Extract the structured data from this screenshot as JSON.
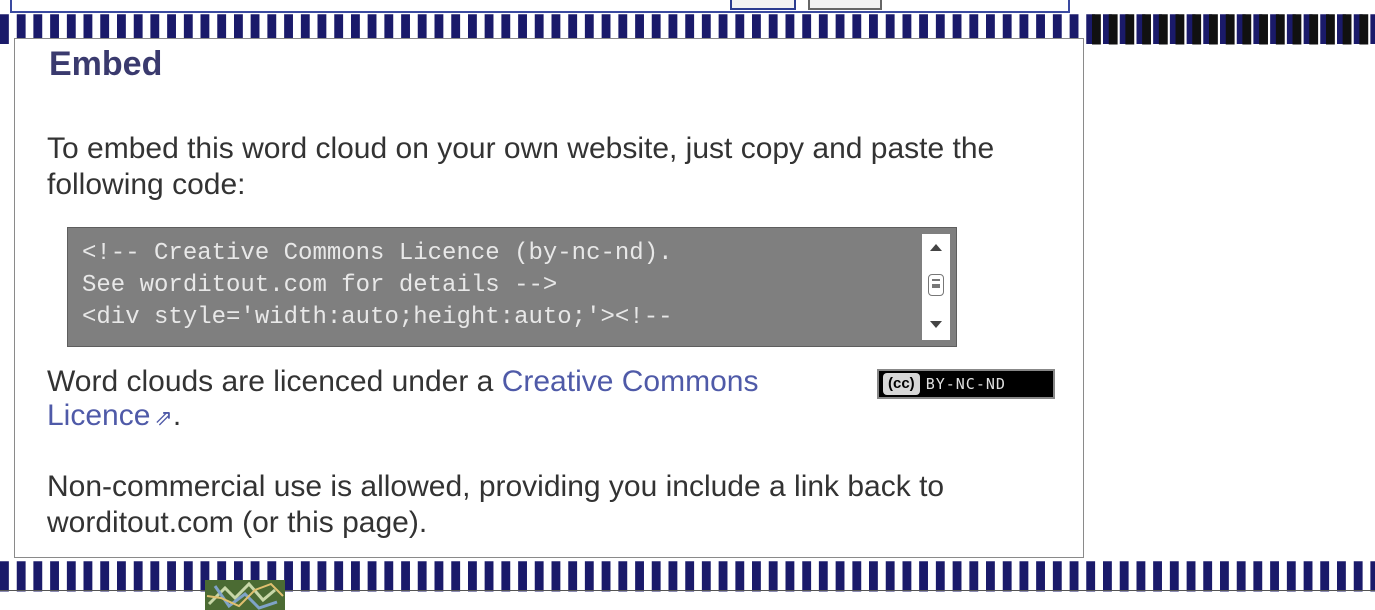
{
  "embed": {
    "title": "Embed",
    "intro": "To embed this word cloud on your own website, just copy and paste the following code:",
    "code_lines": [
      "<!-- Creative Commons Licence (by-nc-nd).",
      "See worditout.com for details -->",
      "<div style='width:auto;height:auto;'><!--"
    ],
    "licence_prefix": "Word clouds are licenced under a ",
    "licence_link": "Creative Commons Licence",
    "licence_suffix": ".",
    "external_icon": "external-link-icon",
    "badge_logo": "(cc)",
    "badge_terms": "BY-NC-ND",
    "noncommercial": "Non-commercial use is allowed, providing you include a link back to worditout.com (or this page)."
  },
  "colors": {
    "title": "#3a3a6e",
    "link": "#4f5aa8",
    "code_background": "#7f7f7f",
    "frame_border": "#3a4aa0"
  }
}
